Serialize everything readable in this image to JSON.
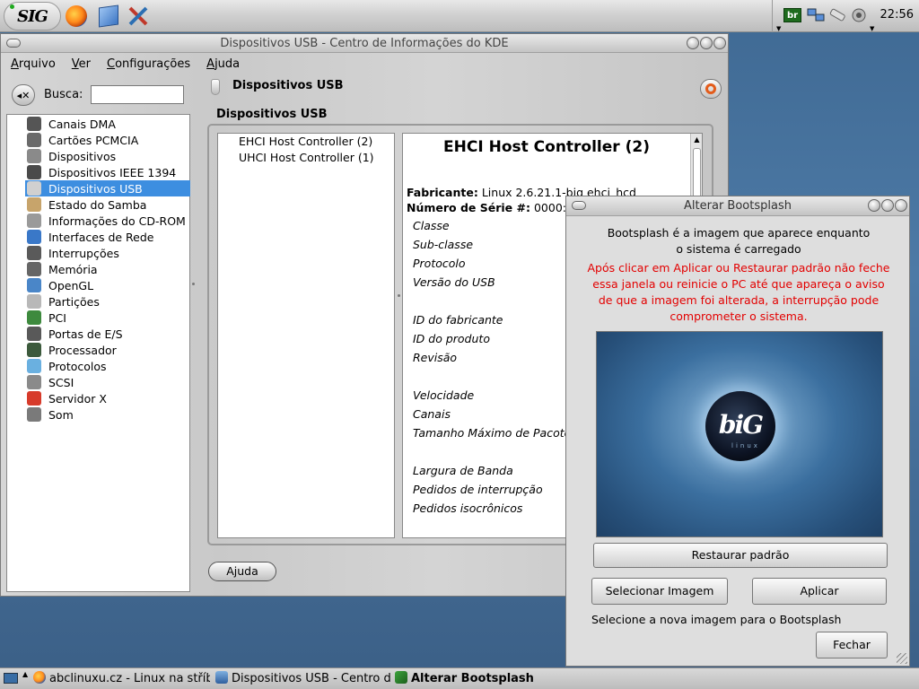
{
  "panel": {
    "launchers": [
      {
        "name": "sig-menu",
        "label": "SIG"
      },
      {
        "name": "firefox-icon"
      },
      {
        "name": "home-folder-icon"
      },
      {
        "name": "config-tools-icon"
      }
    ],
    "clock": "22:56",
    "keyboard_layout": "br"
  },
  "main_window": {
    "title": "Dispositivos USB - Centro de Informações do KDE",
    "menu": [
      "Arquivo",
      "Ver",
      "Configurações",
      "Ajuda"
    ],
    "search_label": "Busca:",
    "search_value": "",
    "modules": [
      {
        "label": "Canais DMA",
        "icon": "chip-icon",
        "color": "#555555"
      },
      {
        "label": "Cartões PCMCIA",
        "icon": "card-icon",
        "color": "#6a6a6a"
      },
      {
        "label": "Dispositivos",
        "icon": "devices-icon",
        "color": "#8a8a8a"
      },
      {
        "label": "Dispositivos IEEE 1394",
        "icon": "firewire-icon",
        "color": "#4a4a4a"
      },
      {
        "label": "Dispositivos USB",
        "icon": "usb-icon",
        "color": "#d0d0d0"
      },
      {
        "label": "Estado do Samba",
        "icon": "samba-icon",
        "color": "#c7a46b"
      },
      {
        "label": "Informações do CD-ROM",
        "icon": "cdrom-icon",
        "color": "#9a9a9a"
      },
      {
        "label": "Interfaces de Rede",
        "icon": "network-icon",
        "color": "#3a78c8"
      },
      {
        "label": "Interrupções",
        "icon": "interrupt-icon",
        "color": "#5a5a5a"
      },
      {
        "label": "Memória",
        "icon": "memory-icon",
        "color": "#666666"
      },
      {
        "label": "OpenGL",
        "icon": "opengl-icon",
        "color": "#4a86c8"
      },
      {
        "label": "Partições",
        "icon": "partition-icon",
        "color": "#b8b8b8"
      },
      {
        "label": "PCI",
        "icon": "pci-icon",
        "color": "#3e8a3e"
      },
      {
        "label": "Portas de E/S",
        "icon": "ioport-icon",
        "color": "#595959"
      },
      {
        "label": "Processador",
        "icon": "cpu-icon",
        "color": "#3c5a3c"
      },
      {
        "label": "Protocolos",
        "icon": "protocols-icon",
        "color": "#6ab0e0"
      },
      {
        "label": "SCSI",
        "icon": "scsi-icon",
        "color": "#8a8a8a"
      },
      {
        "label": "Servidor X",
        "icon": "x-server-icon",
        "color": "#d73b2b"
      },
      {
        "label": "Som",
        "icon": "sound-icon",
        "color": "#7a7a7a"
      }
    ],
    "selected_module": "Dispositivos USB",
    "content_header": "Dispositivos USB",
    "group_title": "Dispositivos USB",
    "controllers": [
      "EHCI Host Controller (2)",
      "UHCI Host Controller (1)"
    ],
    "info": {
      "title": "EHCI Host Controller (2)",
      "manufacturer_label": "Fabricante:",
      "manufacturer_value": "Linux 2.6.21.1-big ehci_hcd",
      "serial_label": "Número de Série #:",
      "serial_value": "0000:",
      "fields": [
        "Classe",
        "Sub-classe",
        "Protocolo",
        "Versão do USB",
        "",
        "ID do fabricante",
        "ID do produto",
        "Revisão",
        "",
        "Velocidade",
        "Canais",
        "Tamanho Máximo de Pacote",
        "",
        "Largura de Banda",
        "Pedidos de interrupção",
        "Pedidos isocrônicos"
      ]
    },
    "help_button": "Ajuda"
  },
  "boot_dialog": {
    "title": "Alterar Bootsplash",
    "description_line1": "Bootsplash é a imagem que aparece enquanto",
    "description_line2": "o sistema é carregado",
    "warning_lines": [
      "Após clicar em Aplicar ou Restaurar padrão não feche",
      "essa janela ou reinicie o PC até que apareça o aviso",
      "de que a imagem foi alterada, a interrupção pode",
      "comprometer o sistema."
    ],
    "preview_logo": "biG",
    "preview_sub": "linux",
    "restore_label": "Restaurar padrão",
    "select_label": "Selecionar Imagem",
    "apply_label": "Aplicar",
    "hint": "Selecione a nova imagem para o Bootsplash",
    "close_label": "Fechar",
    "warning_color": "#e30000"
  },
  "taskbar": {
    "tasks": [
      {
        "label": "abclinuxu.cz - Linux na stříbrném podnose",
        "icon": "firefox-icon"
      },
      {
        "label": "Dispositivos USB - Centro de Informações do KDE",
        "icon": "kinfocenter-icon"
      },
      {
        "label": "Alterar Bootsplash",
        "icon": "bootsplash-icon",
        "active": true
      }
    ]
  }
}
